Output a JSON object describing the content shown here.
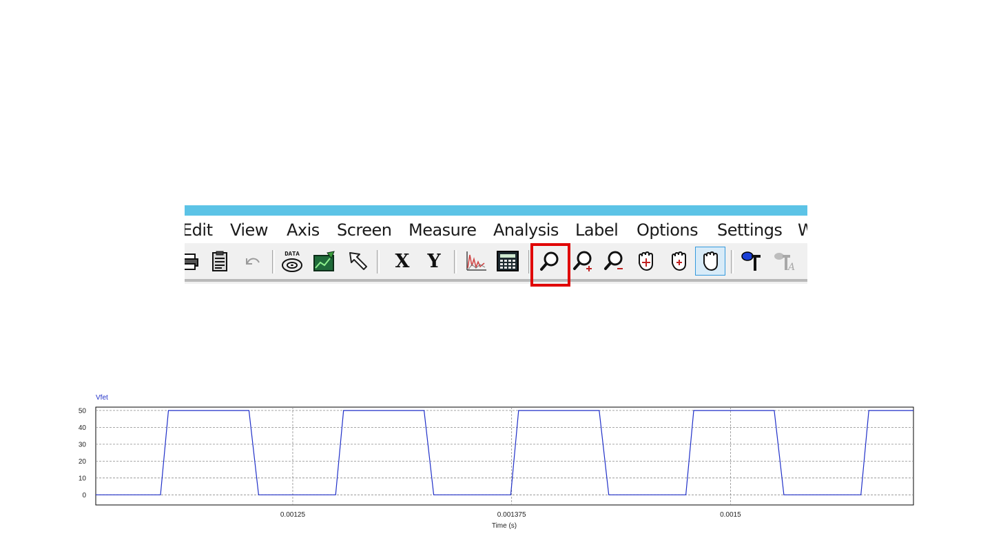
{
  "menubar": {
    "items": [
      "Edit",
      "View",
      "Axis",
      "Screen",
      "Measure",
      "Analysis",
      "Label",
      "Options",
      "Settings",
      "W"
    ]
  },
  "toolbar": {
    "buttons": [
      {
        "icon": "print-icon"
      },
      {
        "icon": "clipboard-icon"
      },
      {
        "icon": "undo-icon"
      },
      {
        "icon": "data-load-icon",
        "text": "DATA"
      },
      {
        "icon": "graph-setup-icon"
      },
      {
        "icon": "select-arrow-icon"
      },
      {
        "icon": "x-axis-icon",
        "text": "X"
      },
      {
        "icon": "y-axis-icon",
        "text": "Y"
      },
      {
        "icon": "fft-icon"
      },
      {
        "icon": "calculator-icon"
      },
      {
        "icon": "zoom-icon",
        "highlighted": true
      },
      {
        "icon": "zoom-in-icon"
      },
      {
        "icon": "zoom-out-icon"
      },
      {
        "icon": "pan-hand-icon"
      },
      {
        "icon": "hand-plus-icon"
      },
      {
        "icon": "hand-pan-icon",
        "pressed": true
      },
      {
        "icon": "label-icon"
      },
      {
        "icon": "text-label-icon",
        "disabled": true
      }
    ]
  },
  "colors": {
    "titlebar": "#5cc3e6",
    "highlight": "#e00000",
    "trace": "#1f2fc8"
  },
  "chart_data": {
    "type": "line",
    "title": "Vfet",
    "xlabel": "Time (s)",
    "ylabel": "",
    "xlim": [
      0.0011375,
      0.0016045
    ],
    "ylim": [
      -6,
      52
    ],
    "x_ticks": [
      0.00125,
      0.001375,
      0.0015
    ],
    "x_tick_labels": [
      "0.00125",
      "0.001375",
      "0.0015"
    ],
    "y_ticks": [
      0,
      10,
      20,
      30,
      40,
      50
    ],
    "y_tick_labels": [
      "0",
      "10",
      "20",
      "30",
      "40",
      "50"
    ],
    "grid": true,
    "series": [
      {
        "name": "Vfet",
        "color": "#1f2fc8",
        "x": [
          0.0011375,
          0.0011745,
          0.001179,
          0.001225,
          0.0012305,
          0.0012745,
          0.001279,
          0.001325,
          0.0013305,
          0.0013745,
          0.001379,
          0.001425,
          0.0014305,
          0.0014745,
          0.001479,
          0.001525,
          0.0015305,
          0.0015745,
          0.001579,
          0.0016045
        ],
        "y": [
          0,
          0,
          50,
          50,
          0,
          0,
          50,
          50,
          0,
          0,
          50,
          50,
          0,
          0,
          50,
          50,
          0,
          0,
          50,
          50
        ]
      }
    ]
  }
}
